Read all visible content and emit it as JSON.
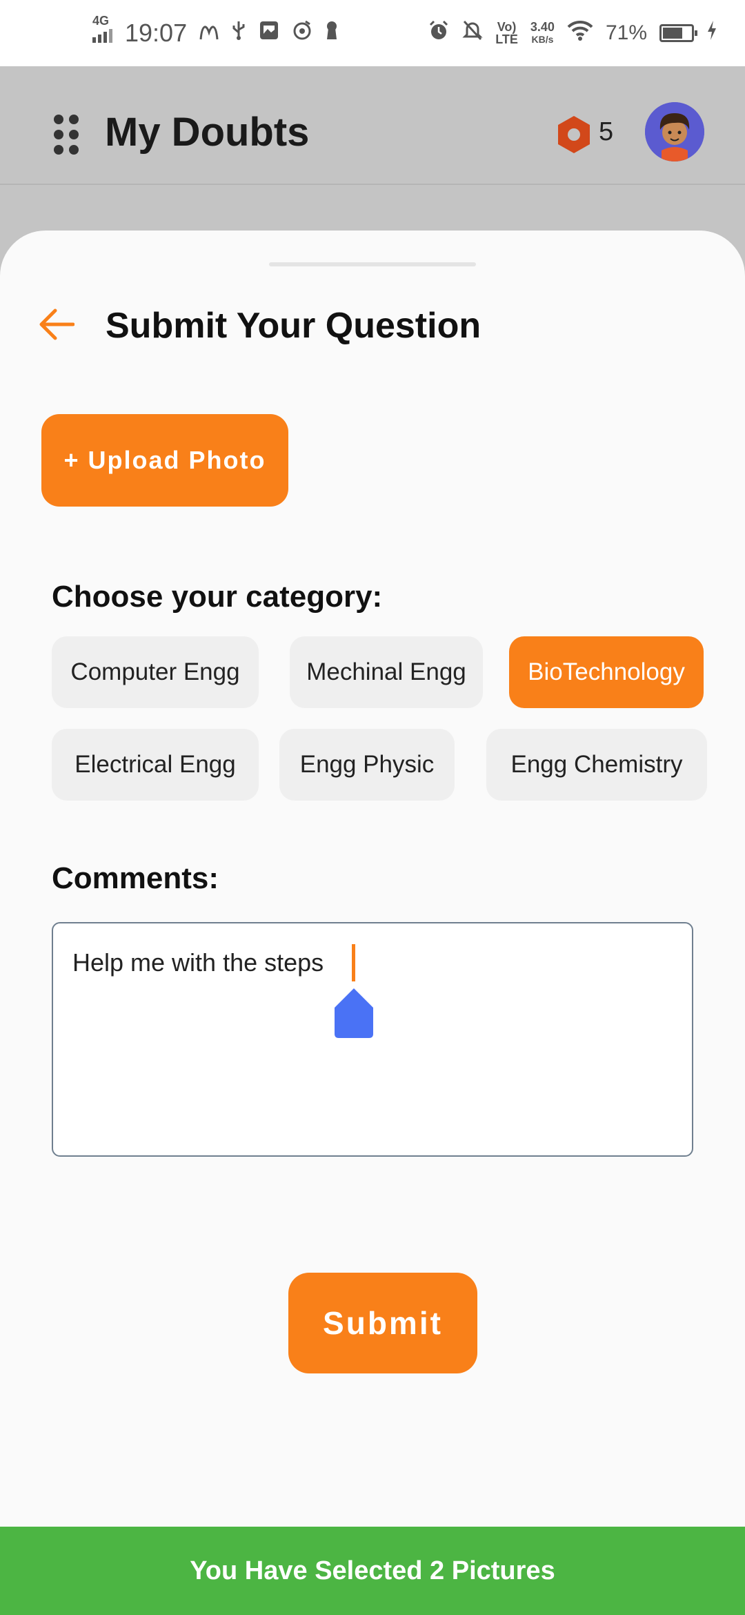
{
  "status_bar": {
    "network": "4G",
    "time": "19:07",
    "volte_top": "Vo)",
    "volte_bottom": "LTE",
    "speed_value": "3.40",
    "speed_unit": "KB/s",
    "battery_percent": "71%",
    "battery_level": 0.71,
    "left_icons": [
      "mcdonalds-icon",
      "usb-icon",
      "gallery-icon",
      "music-icon",
      "keyhole-icon"
    ],
    "right_icons": [
      "alarm-icon",
      "mute-bell-icon",
      "wifi-icon",
      "battery-icon",
      "charging-icon"
    ]
  },
  "app_bar": {
    "title": "My Doubts",
    "coin_count": "5"
  },
  "sheet": {
    "title": "Submit Your Question",
    "upload_label": "+ Upload Photo",
    "category_label": "Choose your category:",
    "categories": [
      {
        "label": "Computer Engg",
        "selected": false
      },
      {
        "label": "Mechinal Engg",
        "selected": false
      },
      {
        "label": "BioTechnology",
        "selected": true
      },
      {
        "label": "Electrical Engg",
        "selected": false
      },
      {
        "label": "Engg Physic",
        "selected": false
      },
      {
        "label": "Engg Chemistry",
        "selected": false
      }
    ],
    "comments_label": "Comments:",
    "comment_value": "Help me with the steps",
    "submit_label": "Submit"
  },
  "snackbar": {
    "message": "You Have Selected 2 Pictures"
  },
  "colors": {
    "accent": "#f98019",
    "success": "#4cb543",
    "coin": "#d2481a",
    "cursor_handle": "#4a72f5"
  }
}
